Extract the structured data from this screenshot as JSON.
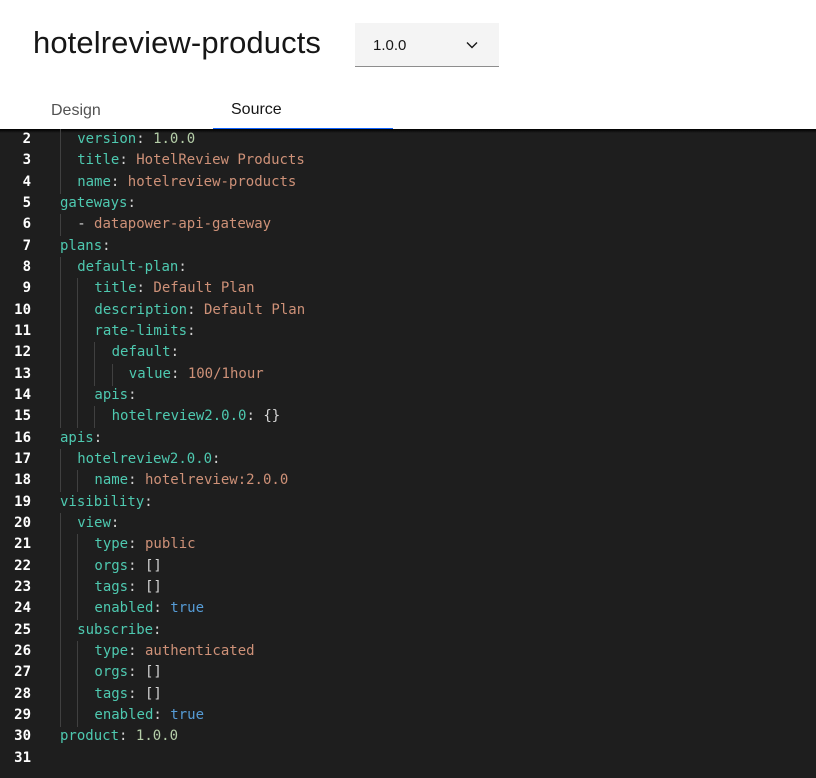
{
  "header": {
    "title": "hotelreview-products",
    "version_select": {
      "value": "1.0.0"
    }
  },
  "tabs": [
    {
      "label": "Design",
      "active": false
    },
    {
      "label": "Source",
      "active": true
    }
  ],
  "editor": {
    "lines": [
      {
        "n": "2",
        "indent": 1,
        "key": "version",
        "value": "1.0.0",
        "vtype": "num"
      },
      {
        "n": "3",
        "indent": 1,
        "key": "title",
        "value": "HotelReview Products",
        "vtype": "str"
      },
      {
        "n": "4",
        "indent": 1,
        "key": "name",
        "value": "hotelreview-products",
        "vtype": "str"
      },
      {
        "n": "5",
        "indent": 0,
        "key": "gateways",
        "value": "",
        "vtype": ""
      },
      {
        "n": "6",
        "indent": 1,
        "key": "",
        "value": "- datapower-api-gateway",
        "vtype": "str"
      },
      {
        "n": "7",
        "indent": 0,
        "key": "plans",
        "value": "",
        "vtype": ""
      },
      {
        "n": "8",
        "indent": 1,
        "key": "default-plan",
        "value": "",
        "vtype": ""
      },
      {
        "n": "9",
        "indent": 2,
        "key": "title",
        "value": "Default Plan",
        "vtype": "str"
      },
      {
        "n": "10",
        "indent": 2,
        "key": "description",
        "value": "Default Plan",
        "vtype": "str"
      },
      {
        "n": "11",
        "indent": 2,
        "key": "rate-limits",
        "value": "",
        "vtype": ""
      },
      {
        "n": "12",
        "indent": 3,
        "key": "default",
        "value": "",
        "vtype": ""
      },
      {
        "n": "13",
        "indent": 4,
        "key": "value",
        "value": "100/1hour",
        "vtype": "str"
      },
      {
        "n": "14",
        "indent": 2,
        "key": "apis",
        "value": "",
        "vtype": ""
      },
      {
        "n": "15",
        "indent": 3,
        "key": "hotelreview2.0.0",
        "value": "{}",
        "vtype": "punct"
      },
      {
        "n": "16",
        "indent": 0,
        "key": "apis",
        "value": "",
        "vtype": ""
      },
      {
        "n": "17",
        "indent": 1,
        "key": "hotelreview2.0.0",
        "value": "",
        "vtype": ""
      },
      {
        "n": "18",
        "indent": 2,
        "key": "name",
        "value": "hotelreview:2.0.0",
        "vtype": "str"
      },
      {
        "n": "19",
        "indent": 0,
        "key": "visibility",
        "value": "",
        "vtype": ""
      },
      {
        "n": "20",
        "indent": 1,
        "key": "view",
        "value": "",
        "vtype": ""
      },
      {
        "n": "21",
        "indent": 2,
        "key": "type",
        "value": "public",
        "vtype": "str"
      },
      {
        "n": "22",
        "indent": 2,
        "key": "orgs",
        "value": "[]",
        "vtype": "punct"
      },
      {
        "n": "23",
        "indent": 2,
        "key": "tags",
        "value": "[]",
        "vtype": "punct"
      },
      {
        "n": "24",
        "indent": 2,
        "key": "enabled",
        "value": "true",
        "vtype": "bool"
      },
      {
        "n": "25",
        "indent": 1,
        "key": "subscribe",
        "value": "",
        "vtype": ""
      },
      {
        "n": "26",
        "indent": 2,
        "key": "type",
        "value": "authenticated",
        "vtype": "str"
      },
      {
        "n": "27",
        "indent": 2,
        "key": "orgs",
        "value": "[]",
        "vtype": "punct"
      },
      {
        "n": "28",
        "indent": 2,
        "key": "tags",
        "value": "[]",
        "vtype": "punct"
      },
      {
        "n": "29",
        "indent": 2,
        "key": "enabled",
        "value": "true",
        "vtype": "bool"
      },
      {
        "n": "30",
        "indent": 0,
        "key": "product",
        "value": "1.0.0",
        "vtype": "num"
      },
      {
        "n": "31",
        "indent": 0,
        "key": "",
        "value": "",
        "vtype": ""
      }
    ]
  },
  "colors": {
    "tab_active_underline": "#0f62fe",
    "editor_background": "#1e1e1e",
    "yaml_key": "#4ec9b0",
    "yaml_string": "#ce9178",
    "yaml_number": "#b5cea8",
    "yaml_boolean": "#569cd6"
  }
}
